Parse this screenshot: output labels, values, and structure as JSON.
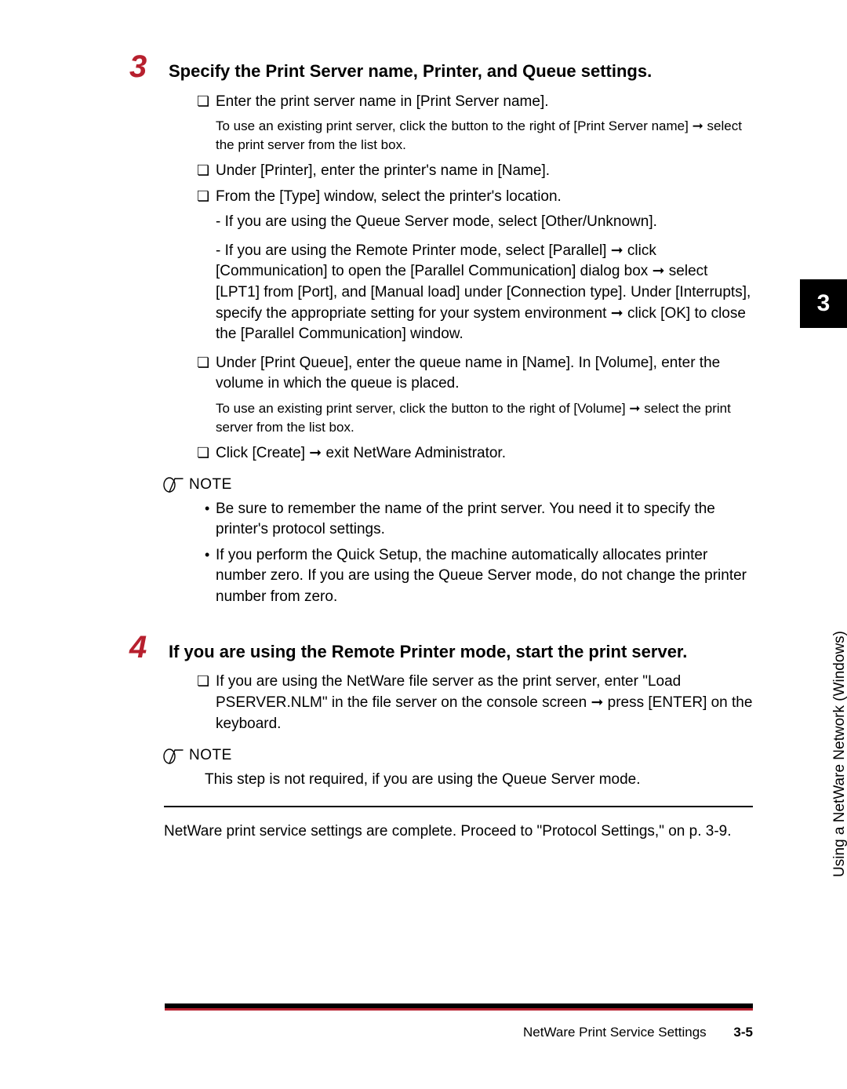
{
  "side_tab": {
    "chapter": "3",
    "label": "Using a NetWare Network (Windows)"
  },
  "arrow": "➞",
  "steps": [
    {
      "num": "3",
      "title": "Specify the Print Server name, Printer, and Queue settings.",
      "items": {
        "c1": "Enter the print server name in [Print Server name].",
        "s1": "To use an existing print server, click the button to the right of [Print Server name] ➞ select the print server from the list box.",
        "c2": "Under [Printer], enter the printer's name in [Name].",
        "c3": "From the [Type] window, select the printer's location.",
        "d1": "- If you are using the Queue Server mode, select [Other/Unknown].",
        "d2": "- If you are using the Remote Printer mode, select [Parallel] ➞ click [Communication] to open the [Parallel Communication] dialog box ➞ select [LPT1] from [Port], and [Manual load] under [Connection type]. Under [Interrupts], specify the appropriate setting for your system environment ➞ click [OK] to close the [Parallel Communication] window.",
        "c4": "Under [Print Queue], enter the queue name in [Name]. In [Volume], enter the volume in which the queue is placed.",
        "s4": "To use an existing print server, click the button to the right of [Volume] ➞ select the print server from the list box.",
        "c5": "Click [Create] ➞ exit NetWare Administrator."
      },
      "note": {
        "label": "NOTE",
        "b1": "Be sure to remember the name of the print server. You need it to specify the printer's protocol settings.",
        "b2": "If you perform the Quick Setup, the machine automatically allocates printer number zero. If you are using the Queue Server mode, do not change the printer number from zero."
      }
    },
    {
      "num": "4",
      "title": "If you are using the Remote Printer mode, start the print server.",
      "items": {
        "c1": "If you are using the NetWare file server as the print server, enter \"Load PSERVER.NLM\" in the file server on the console screen ➞ press [ENTER] on the keyboard."
      },
      "note": {
        "label": "NOTE",
        "text": "This step is not required, if you are using the Queue Server mode."
      }
    }
  ],
  "closing": "NetWare print service settings are complete. Proceed to \"Protocol Settings,\" on p. 3-9.",
  "footer": {
    "section": "NetWare Print Service Settings",
    "page": "3-5"
  }
}
